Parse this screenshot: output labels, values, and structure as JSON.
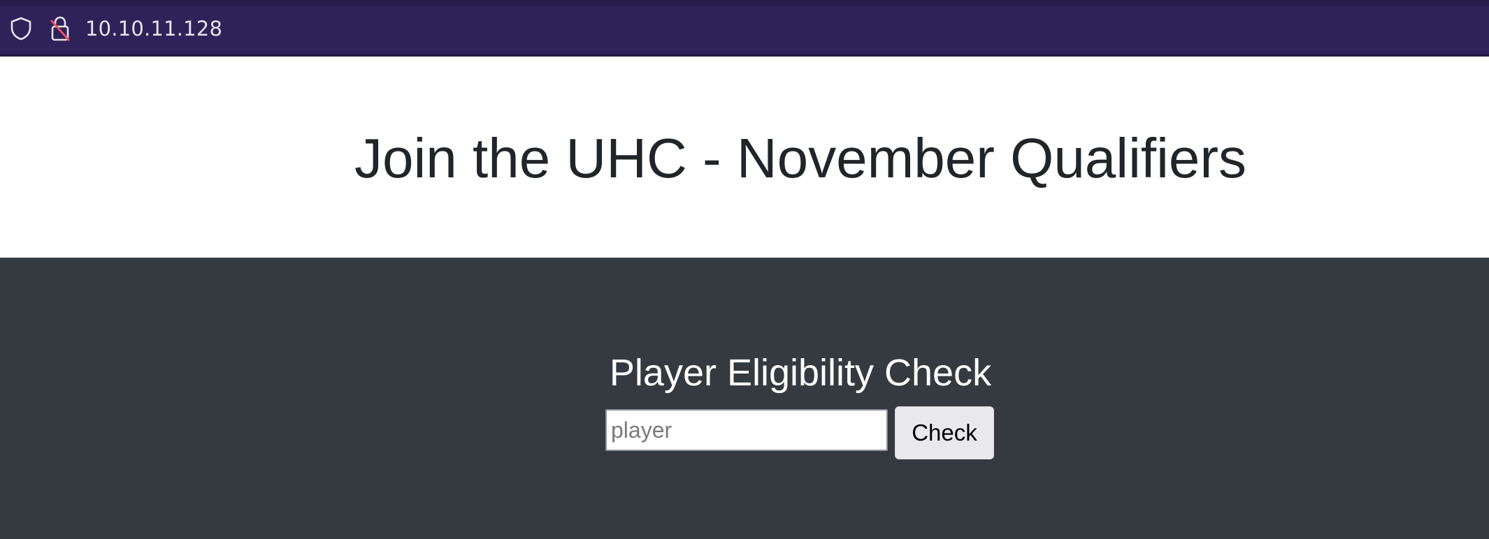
{
  "browser": {
    "url": "10.10.11.128",
    "tracking_icon": "shield-icon",
    "security_icon": "insecure-lock-icon"
  },
  "hero": {
    "title": "Join the UHC - November Qualifiers"
  },
  "eligibility": {
    "heading": "Player Eligibility Check",
    "input_placeholder": "player",
    "input_value": "",
    "button_label": "Check"
  },
  "colors": {
    "browser_bar": "#2f2259",
    "hero_background": "#ffffff",
    "section_background": "#343a40",
    "title_text": "#212529",
    "heading_text": "#ffffff",
    "button_background": "#e9e9ed"
  }
}
